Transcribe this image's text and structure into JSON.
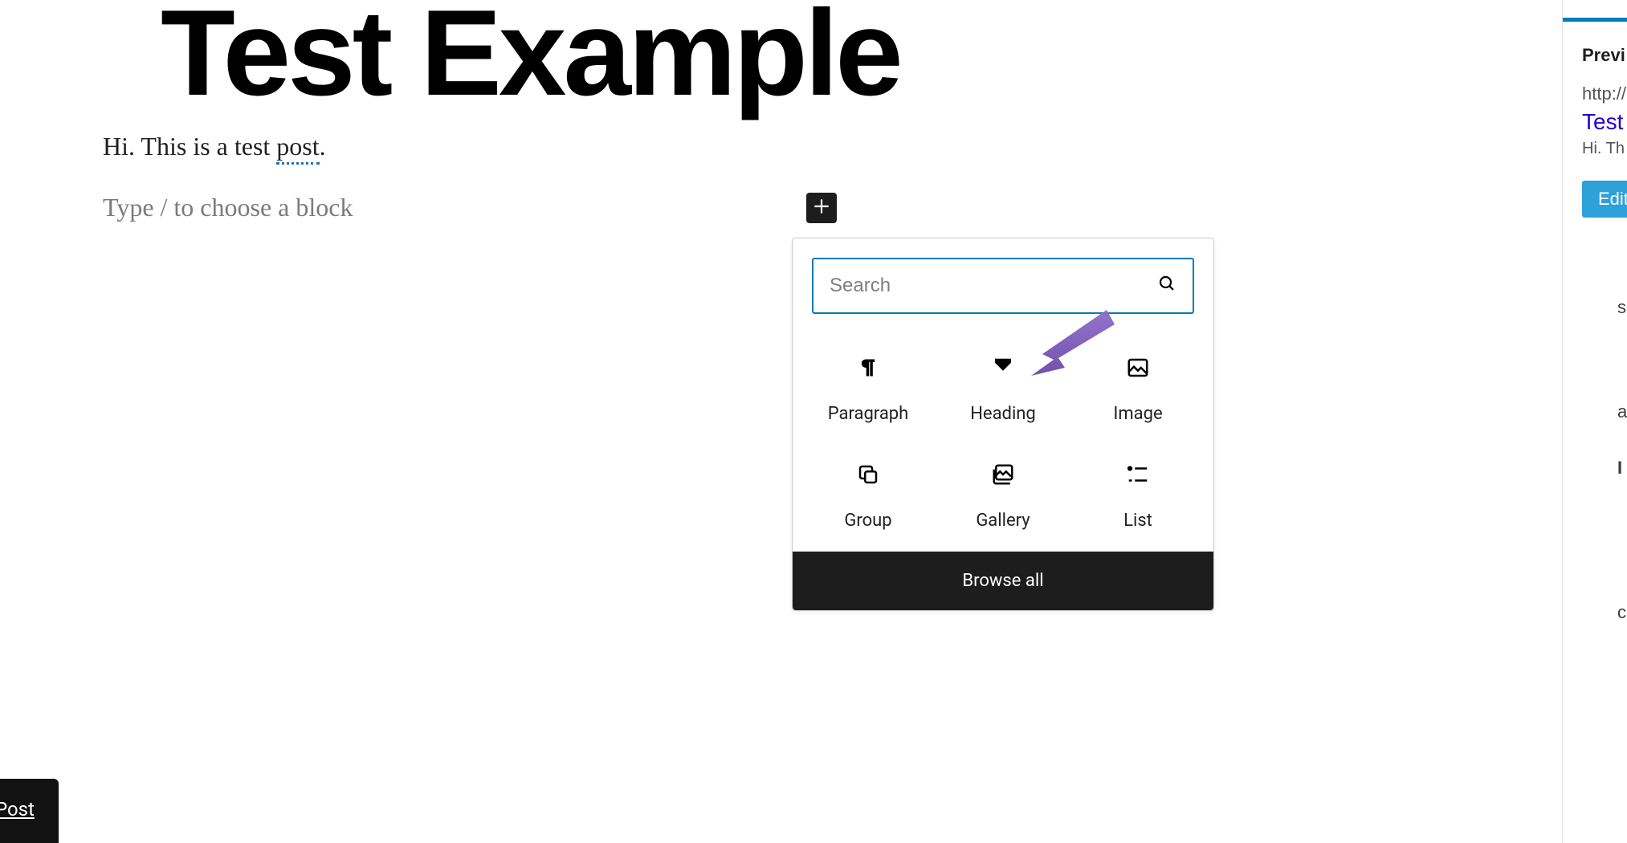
{
  "editor": {
    "post_title": "Test Example",
    "paragraph_prefix": "Hi. This is a test ",
    "paragraph_underlined": "post",
    "paragraph_suffix": ".",
    "placeholder": "Type / to choose a block"
  },
  "inserter": {
    "search_placeholder": "Search",
    "blocks": [
      {
        "name": "Paragraph"
      },
      {
        "name": "Heading"
      },
      {
        "name": "Image"
      },
      {
        "name": "Group"
      },
      {
        "name": "Gallery"
      },
      {
        "name": "List"
      }
    ],
    "browse_all": "Browse all"
  },
  "sidebar": {
    "preview_label": "Previ",
    "url": "http://",
    "link_title": "Test ",
    "excerpt": "Hi. Th",
    "edit_button": "Edit",
    "trailing_letters": [
      "s",
      "a",
      "I",
      "c"
    ]
  },
  "snackbar": {
    "text": "w Post"
  },
  "colors": {
    "brand": "#007cba",
    "arrow": "#8661c5"
  }
}
